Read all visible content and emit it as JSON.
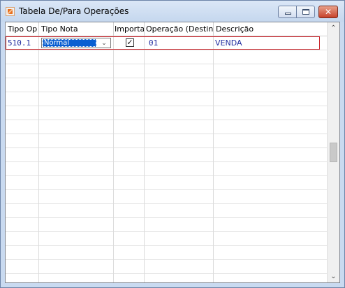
{
  "window": {
    "title": "Tabela De/Para Operações",
    "controls": {
      "minimize": "–",
      "maximize": "□",
      "close": "✕"
    }
  },
  "grid": {
    "columns": [
      "Tipo Op",
      "Tipo Nota",
      "Importar",
      "Operação (Destino)",
      "Descrição"
    ],
    "rows": [
      {
        "tipo_op": "510.1",
        "tipo_nota": "Normal",
        "importar": true,
        "importar_mark": "✓",
        "operacao_destino": "01",
        "descricao": "VENDA"
      }
    ]
  },
  "icons": {
    "app": "app-logo-icon",
    "dropdown": "chevron-down-icon",
    "scroll_up": "chevron-up-icon",
    "scroll_down": "chevron-down-icon"
  },
  "scroll": {
    "up": "⌃",
    "down": "⌄",
    "dropdown": "⌄"
  },
  "colors": {
    "selection_border": "#c9262c",
    "cell_text": "#1f2b9f",
    "dropdown_highlight": "#0a5fd1"
  }
}
